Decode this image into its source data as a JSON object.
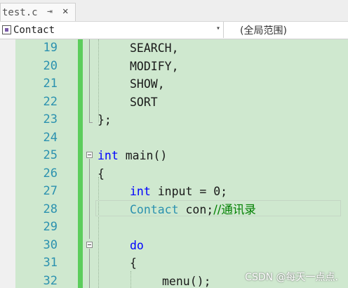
{
  "tab": {
    "file_name": "test.c",
    "pin_glyph": "⇥",
    "close_glyph": "✕"
  },
  "navbar": {
    "scope_left": "Contact",
    "scope_right": "(全局范围)"
  },
  "editor": {
    "line_numbers": [
      "19",
      "20",
      "21",
      "22",
      "23",
      "24",
      "25",
      "26",
      "27",
      "28",
      "29",
      "30",
      "31",
      "32"
    ],
    "lines": {
      "l19": "SEARCH,",
      "l20": "MODIFY,",
      "l21": "SHOW,",
      "l22": "SORT",
      "l23": "};",
      "l25_kw": "int",
      "l25_rest": " main()",
      "l26": "{",
      "l27_kw": "int",
      "l27_rest": " input = 0;",
      "l28_type": "Contact",
      "l28_rest": " con;",
      "l28_comment": "//通讯录",
      "l30_kw": "do",
      "l31": "{",
      "l32": "menu();"
    }
  },
  "watermark": "CSDN @每天一点点.",
  "colors": {
    "editor_bg": "#cfe8cf",
    "line_number": "#2b91af",
    "keyword": "#0000ff",
    "type": "#2b91af",
    "comment": "#008000",
    "change_bar": "#5ccd5c"
  }
}
